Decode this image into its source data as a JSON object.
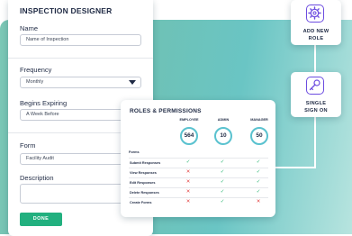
{
  "designer": {
    "title": "INSPECTION DESIGNER",
    "name_label": "Name",
    "name_value": "Name of Inspection",
    "frequency_label": "Frequency",
    "frequency_value": "Monthly",
    "begins_label": "Begins Expiring",
    "begins_value": "A Week Before",
    "form_label": "Form",
    "form_value": "Facility Audit",
    "description_label": "Description",
    "done_label": "DONE"
  },
  "roles": {
    "title": "ROLES & PERMISSIONS",
    "columns": [
      {
        "label": "EMPLOYEE",
        "count": "564"
      },
      {
        "label": "ADMIN",
        "count": "10"
      },
      {
        "label": "MANAGER",
        "count": "50"
      }
    ],
    "section": "Forms",
    "rows": [
      {
        "label": "Submit Responses",
        "perms": [
          true,
          true,
          true
        ]
      },
      {
        "label": "View Responses",
        "perms": [
          false,
          true,
          true
        ]
      },
      {
        "label": "Edit Responses",
        "perms": [
          false,
          true,
          true
        ]
      },
      {
        "label": "Delete Responses",
        "perms": [
          false,
          true,
          true
        ]
      },
      {
        "label": "Create Forms",
        "perms": [
          false,
          true,
          false
        ]
      }
    ]
  },
  "side_cards": {
    "add_role": {
      "line1": "ADD NEW",
      "line2": "ROLE",
      "icon": "gear-icon"
    },
    "sso": {
      "line1": "SINGLE",
      "line2": "SIGN ON",
      "icon": "key-icon"
    }
  },
  "colors": {
    "accent": "#22b07f",
    "brand_purple": "#6c4ce0",
    "circle": "#5ac2cf",
    "check": "#2bb673",
    "cross": "#e23c3c"
  }
}
